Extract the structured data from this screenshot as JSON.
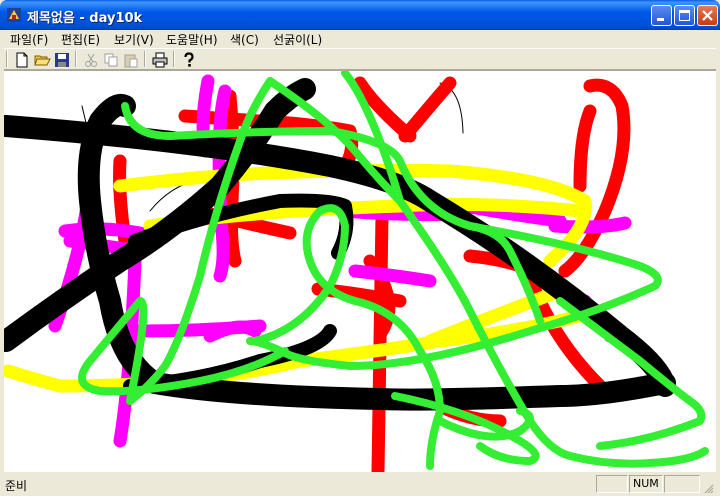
{
  "window": {
    "title": "제목없음 - day10k"
  },
  "menu": {
    "items": [
      "파일(F)",
      "편집(E)",
      "보기(V)",
      "도움말(H)",
      "색(C)",
      "선굵이(L)"
    ]
  },
  "toolbar": {
    "buttons": [
      {
        "name": "new-icon",
        "enabled": true
      },
      {
        "name": "open-icon",
        "enabled": true
      },
      {
        "name": "save-icon",
        "enabled": true
      },
      {
        "name": "cut-icon",
        "enabled": false
      },
      {
        "name": "copy-icon",
        "enabled": false
      },
      {
        "name": "paste-icon",
        "enabled": false
      },
      {
        "name": "print-icon",
        "enabled": true
      },
      {
        "name": "help-icon",
        "enabled": true
      }
    ]
  },
  "canvas": {
    "stroke_colors": {
      "black": "#000000",
      "red": "#FF0000",
      "magenta": "#FF00FF",
      "yellow": "#FFFF00",
      "green": "#33EE33"
    }
  },
  "status": {
    "message": "준비",
    "indicators": [
      "",
      "NUM",
      ""
    ]
  },
  "colors": {
    "titlebar": "#0058E6",
    "face": "#ECE9D8",
    "canvas_bg": "#FFFFFF"
  }
}
